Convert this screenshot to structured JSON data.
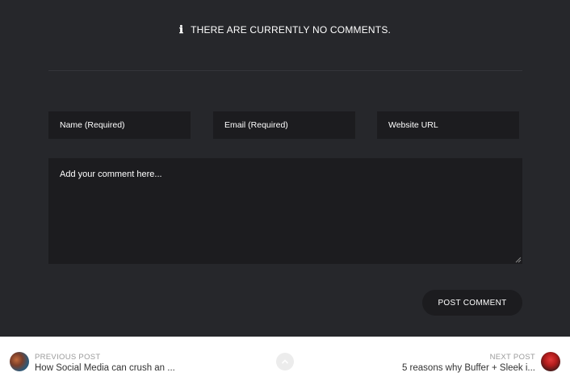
{
  "comments": {
    "empty_message": "THERE ARE CURRENTLY NO COMMENTS.",
    "info_icon": "ℹ"
  },
  "form": {
    "name_placeholder": "Name (Required)",
    "email_placeholder": "Email (Required)",
    "website_placeholder": "Website URL",
    "comment_placeholder": "Add your comment here...",
    "submit_label": "POST COMMENT"
  },
  "post_nav": {
    "previous_label": "PREVIOUS POST",
    "previous_title": "How Social Media can crush an ...",
    "next_label": "NEXT POST",
    "next_title": "5 reasons why Buffer + Sleek i...",
    "up_icon": "chevron-up-icon"
  },
  "colors": {
    "background": "#26272b",
    "field_background": "#1c1c1f",
    "nav_background": "#ffffff"
  }
}
